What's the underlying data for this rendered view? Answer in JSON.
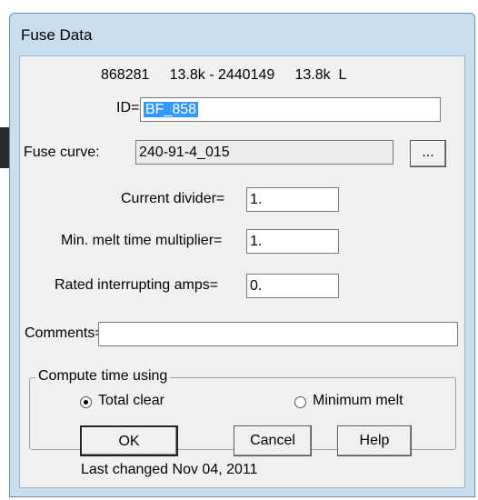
{
  "window": {
    "title": "Fuse Data"
  },
  "header": {
    "line": "868281     13.8k - 2440149     13.8k  L"
  },
  "id_field": {
    "label": "ID=",
    "value": "BF_858"
  },
  "fuse_curve": {
    "label": "Fuse curve:",
    "value": "240-91-4_015",
    "browse_label": "..."
  },
  "current_divider": {
    "label": "Current divider=",
    "value": "1."
  },
  "min_melt_multiplier": {
    "label": "Min. melt time multiplier=",
    "value": "1."
  },
  "rated_interrupting": {
    "label": "Rated interrupting amps=",
    "value": "0."
  },
  "comments": {
    "label": "Comments=",
    "value": ""
  },
  "compute_group": {
    "legend": "Compute time using",
    "options": [
      {
        "label": "Total clear",
        "selected": true
      },
      {
        "label": "Minimum melt",
        "selected": false
      }
    ]
  },
  "buttons": {
    "ok": "OK",
    "cancel": "Cancel",
    "help": "Help"
  },
  "footer": {
    "last_changed": "Last changed Nov 04, 2011"
  }
}
